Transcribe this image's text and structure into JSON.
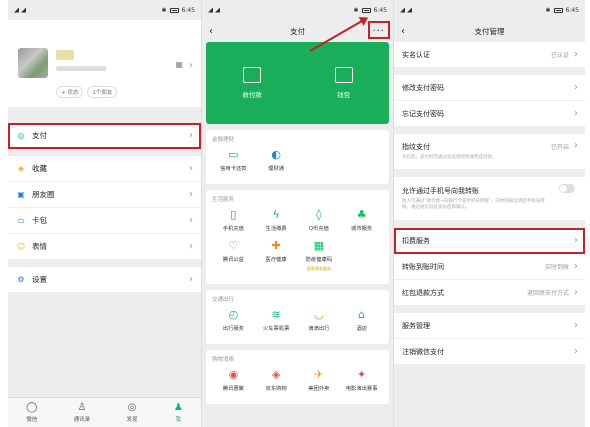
{
  "status": {
    "time": "6:45"
  },
  "me": {
    "tags": [
      "+ 状态",
      "1个朋友"
    ],
    "menu": [
      {
        "label": "支付",
        "icon": "pay-icon"
      },
      {
        "label": "收藏",
        "icon": "favorites-icon"
      },
      {
        "label": "朋友圈",
        "icon": "moments-icon"
      },
      {
        "label": "卡包",
        "icon": "cards-icon"
      },
      {
        "label": "表情",
        "icon": "sticker-icon"
      },
      {
        "label": "设置",
        "icon": "settings-icon"
      }
    ],
    "tabs": [
      {
        "label": "微信",
        "icon": "chat-icon"
      },
      {
        "label": "通讯录",
        "icon": "contacts-icon"
      },
      {
        "label": "发现",
        "icon": "discover-icon"
      },
      {
        "label": "我",
        "icon": "me-icon"
      }
    ]
  },
  "pay": {
    "title": "支付",
    "more": "···",
    "green": [
      {
        "label": "收付款",
        "icon": "scan-qr-icon"
      },
      {
        "label": "钱包",
        "icon": "wallet-icon"
      }
    ],
    "sections": [
      {
        "title": "金融理财",
        "items": [
          {
            "label": "信用卡还款",
            "icon": "credit-card-icon"
          },
          {
            "label": "理财通",
            "icon": "wealth-icon"
          }
        ]
      },
      {
        "title": "生活服务",
        "items": [
          {
            "label": "手机充值",
            "icon": "phone-icon"
          },
          {
            "label": "生活缴费",
            "icon": "utility-icon"
          },
          {
            "label": "Q币充值",
            "icon": "qcoin-icon"
          },
          {
            "label": "城市服务",
            "icon": "city-icon"
          },
          {
            "label": "腾讯公益",
            "icon": "charity-icon"
          },
          {
            "label": "医疗健康",
            "icon": "medical-icon"
          },
          {
            "label": "防疫健康码",
            "icon": "healthcode-icon",
            "sub": "国家政务服务"
          }
        ]
      },
      {
        "title": "交通出行",
        "items": [
          {
            "label": "出行服务",
            "icon": "travel-icon"
          },
          {
            "label": "火车票机票",
            "icon": "train-icon"
          },
          {
            "label": "滴滴出行",
            "icon": "didi-icon"
          },
          {
            "label": "酒店",
            "icon": "hotel-icon"
          }
        ]
      },
      {
        "title": "购物消费",
        "items": [
          {
            "label": "腾讯惠聚",
            "icon": "shop-icon"
          },
          {
            "label": "京东购物",
            "icon": "jd-icon"
          },
          {
            "label": "美团外卖",
            "icon": "meituan-icon"
          },
          {
            "label": "电影演出赛事",
            "icon": "movie-icon"
          }
        ]
      }
    ]
  },
  "mgmt": {
    "title": "支付管理",
    "rows": [
      {
        "label": "实名认证",
        "value": "已认证",
        "gap_after": true
      },
      {
        "label": "修改支付密码",
        "value": ""
      },
      {
        "label": "忘记支付密码",
        "value": "",
        "gap_after": true
      },
      {
        "label": "指纹支付",
        "value": "已开启",
        "desc": "开启后，支付时可通过验证指纹快速完成付款。",
        "tall": true,
        "gap_after": true
      },
      {
        "label": "允许通过手机号向我转账",
        "toggle": true,
        "desc": "他人可通过\"收付款→向银行卡或手机号转账\"，向你的微信绑定手机号转账，通过短信验证身份后再确认。",
        "tall": true,
        "gap_after": true
      },
      {
        "label": "扣费服务",
        "value": "",
        "highlight": true
      },
      {
        "label": "转账到账时间",
        "value": "实时到账"
      },
      {
        "label": "红包退款方式",
        "value": "退回原支付方式",
        "gap_after": true
      },
      {
        "label": "服务管理",
        "value": ""
      },
      {
        "label": "注销微信支付",
        "value": ""
      }
    ]
  }
}
